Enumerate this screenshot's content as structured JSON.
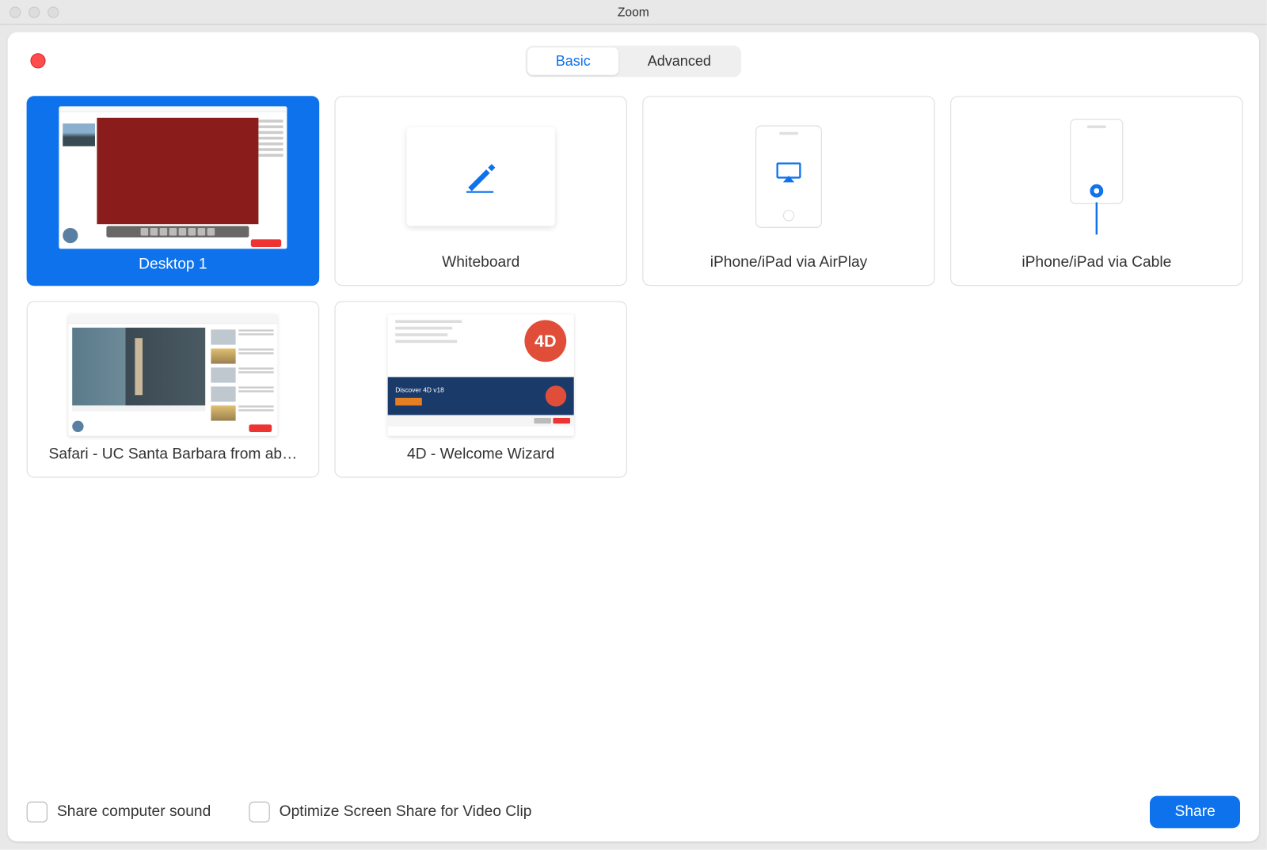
{
  "window": {
    "title": "Zoom"
  },
  "tabs": {
    "basic": "Basic",
    "advanced": "Advanced",
    "active": "basic"
  },
  "options": [
    {
      "id": "desktop1",
      "label": "Desktop 1",
      "kind": "desktop",
      "selected": true
    },
    {
      "id": "whiteboard",
      "label": "Whiteboard",
      "kind": "whiteboard",
      "selected": false
    },
    {
      "id": "airplay",
      "label": "iPhone/iPad via AirPlay",
      "kind": "airplay",
      "selected": false
    },
    {
      "id": "cable",
      "label": "iPhone/iPad via Cable",
      "kind": "cable",
      "selected": false
    },
    {
      "id": "safari",
      "label": "Safari - UC Santa Barbara from ab…",
      "kind": "safari",
      "selected": false
    },
    {
      "id": "4d",
      "label": "4D - Welcome Wizard",
      "kind": "4d",
      "selected": false
    }
  ],
  "thumb_4d": {
    "logo_text": "4D",
    "banner_title": "Discover 4D v18"
  },
  "footer": {
    "share_sound": "Share computer sound",
    "optimize_video": "Optimize Screen Share for Video Clip",
    "share_button": "Share"
  }
}
